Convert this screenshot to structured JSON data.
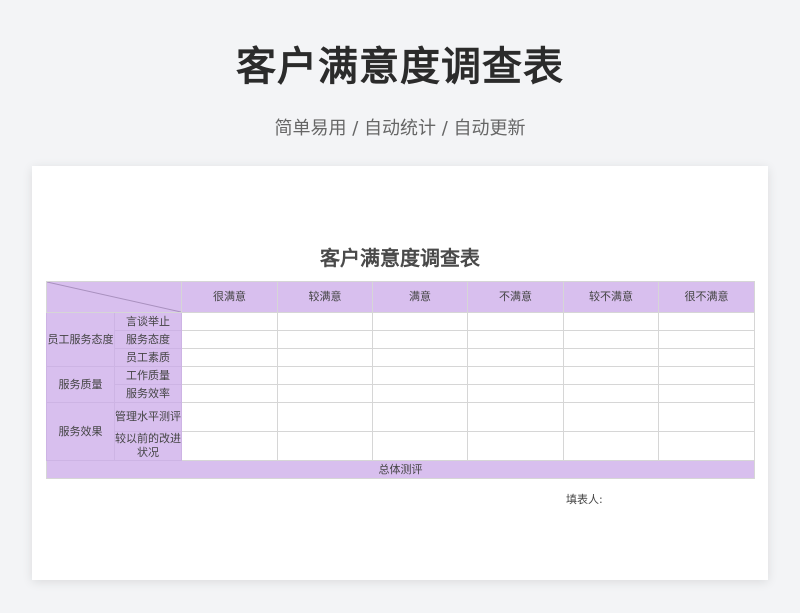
{
  "page": {
    "title": "客户满意度调查表",
    "subtitle": "简单易用 / 自动统计 / 自动更新"
  },
  "sheet": {
    "title": "客户满意度调查表",
    "columns": [
      "很满意",
      "较满意",
      "满意",
      "不满意",
      "较不满意",
      "很不满意"
    ],
    "groups": [
      {
        "name": "员工服务态度",
        "items": [
          "言谈举止",
          "服务态度",
          "员工素质"
        ]
      },
      {
        "name": "服务质量",
        "items": [
          "工作质量",
          "服务效率"
        ]
      },
      {
        "name": "服务效果",
        "items": [
          "管理水平测评",
          "较以前的改进状况"
        ]
      }
    ],
    "total_label": "总体测评",
    "filler_label": "填表人:"
  }
}
